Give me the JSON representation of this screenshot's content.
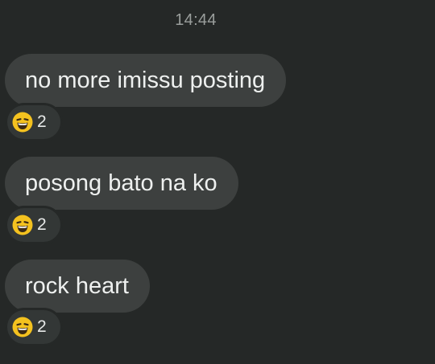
{
  "chat": {
    "timestamp": "14:44",
    "messages": [
      {
        "text": "no more imissu posting",
        "reaction": {
          "icon": "laughing-face-emoji",
          "count": "2"
        }
      },
      {
        "text": "posong bato na ko",
        "reaction": {
          "icon": "laughing-face-emoji",
          "count": "2"
        }
      },
      {
        "text": "rock heart",
        "reaction": {
          "icon": "laughing-face-emoji",
          "count": "2"
        }
      }
    ]
  },
  "colors": {
    "background": "#252827",
    "bubble": "#3d403f",
    "text": "#eef0ef",
    "timestamp": "#9a9e9c",
    "emoji_face": "#f4c21f"
  }
}
